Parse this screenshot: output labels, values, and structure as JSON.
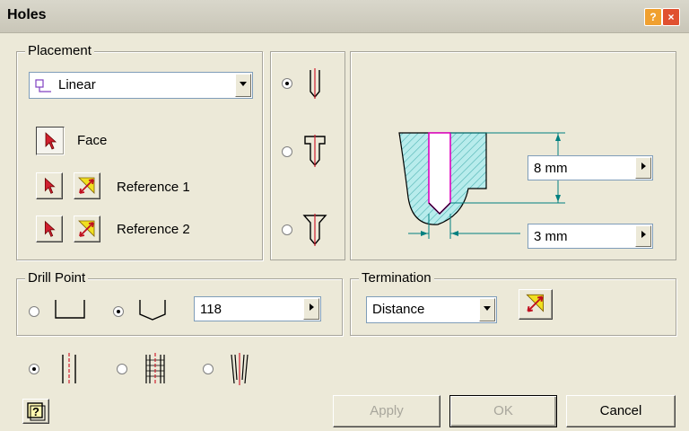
{
  "window": {
    "title": "Holes"
  },
  "placement": {
    "legend": "Placement",
    "mode_value": "Linear",
    "face_label": "Face",
    "ref1_label": "Reference 1",
    "ref2_label": "Reference 2"
  },
  "preview": {
    "depth_value": "8 mm",
    "diameter_value": "3 mm"
  },
  "drill_point": {
    "legend": "Drill Point",
    "angle_value": "118"
  },
  "termination": {
    "legend": "Termination",
    "type_value": "Distance"
  },
  "buttons": {
    "apply": "Apply",
    "ok": "OK",
    "cancel": "Cancel"
  },
  "icons": {
    "titlebar": [
      "help-icon",
      "close-icon"
    ],
    "hole_types": [
      "drilled-hole-icon",
      "counterbore-hole-icon",
      "countersink-hole-icon"
    ],
    "drill_points": [
      "flat-point-icon",
      "angled-point-icon"
    ],
    "thread_types": [
      "simple-hole-icon",
      "tapped-hole-icon",
      "taper-tapped-hole-icon"
    ]
  }
}
